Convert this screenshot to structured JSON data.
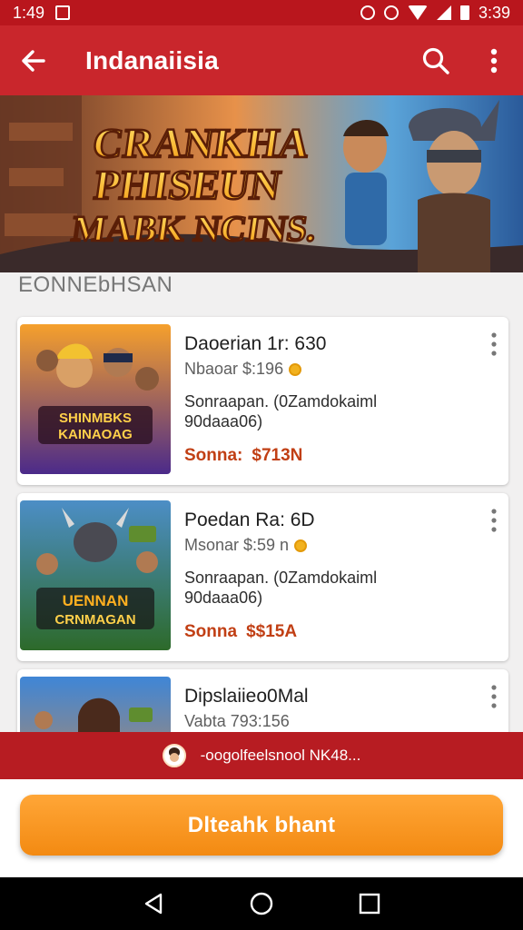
{
  "status_bar": {
    "time_left": "1:49",
    "time_right": "3:39"
  },
  "app_bar": {
    "title": "Indanaiisia"
  },
  "banner": {
    "line1": "CRANKHA",
    "line2": "PHISEUN",
    "line3": "MABK NCINS."
  },
  "section": {
    "label": "EONNEbHSAN"
  },
  "cards": [
    {
      "name": "Daoerian 1r: 630",
      "sub": "Nbaoar $:196",
      "desc1": "Sonraapan. (0Zamdokaiml",
      "desc2": "90daaa06)",
      "price_label": "Sonna:",
      "price_value": "$713N",
      "art_title1": "SHINMBKS",
      "art_title2": "KAINAOAG"
    },
    {
      "name": "Poedan Ra: 6D",
      "sub": "Msonar $:59 n",
      "desc1": "Sonraapan. (0Zamdokaiml",
      "desc2": "90daaa06)",
      "price_label": "Sonna",
      "price_value": "$$15A",
      "art_title1": "UENNAN",
      "art_title2": "CRNMAGAN"
    },
    {
      "name": "Dipslaiieo0Mal",
      "sub": "Vabta 793:156"
    }
  ],
  "promo": {
    "text": "-oogolfeelsnool  NK48..."
  },
  "cta": {
    "label": "Dlteahk bhant"
  },
  "colors": {
    "brand_red": "#c9262c",
    "status_red": "#b9161d",
    "promo_red": "#b71c22",
    "cta_orange": "#f38a12",
    "price_orange": "#c13f14"
  }
}
